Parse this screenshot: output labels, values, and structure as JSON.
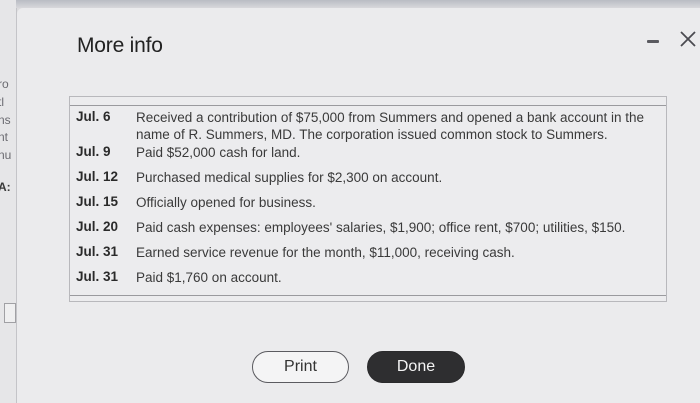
{
  "background": {
    "fragments": [
      "ro",
      "tl",
      "ns",
      "nt",
      "nu",
      "A:"
    ]
  },
  "dialog": {
    "title": "More info",
    "minimize_icon": "minimize-icon",
    "close_icon": "close-icon"
  },
  "transactions": [
    {
      "date": "Jul. 6",
      "description": "Received a contribution of $75,000 from Summers and opened a bank account in the name of R. Summers, MD. The corporation issued common stock to Summers."
    },
    {
      "date": "Jul. 9",
      "description": "Paid $52,000 cash for land."
    },
    {
      "date": "Jul. 12",
      "description": "Purchased medical supplies for $2,300 on account."
    },
    {
      "date": "Jul. 15",
      "description": "Officially opened for business."
    },
    {
      "date": "Jul. 20",
      "description": "Paid cash expenses: employees' salaries, $1,900; office rent, $700; utilities, $150."
    },
    {
      "date": "Jul. 31",
      "description": "Earned service revenue for the month, $11,000, receiving cash."
    },
    {
      "date": "Jul. 31",
      "description": "Paid $1,760 on account."
    }
  ],
  "buttons": {
    "print": "Print",
    "done": "Done"
  }
}
